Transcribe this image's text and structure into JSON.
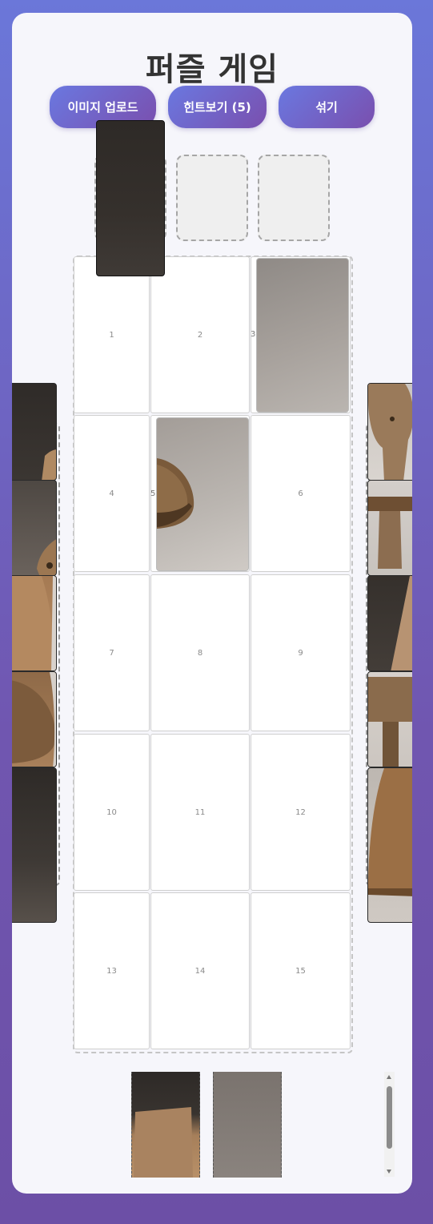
{
  "title": "퍼즐 게임",
  "buttons": {
    "upload": "이미지 업로드",
    "hint": "힌트보기 (5)",
    "shuffle": "섞기"
  },
  "board": {
    "cells": [
      "1",
      "2",
      "3",
      "4",
      "5",
      "6",
      "7",
      "8",
      "9",
      "10",
      "11",
      "12",
      "13",
      "14",
      "15"
    ]
  },
  "colors": {
    "accent_start": "#6a78e0",
    "accent_end": "#7a4fae",
    "background": "#6c5fc4"
  }
}
